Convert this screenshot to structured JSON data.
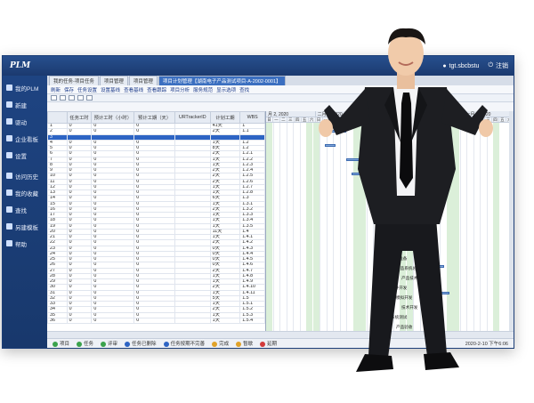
{
  "window": {
    "title": "PLM",
    "user": "tgt.sbcbstu",
    "logout": "注销"
  },
  "sidebar": {
    "items": [
      {
        "label": "我的PLM"
      },
      {
        "label": "新建"
      },
      {
        "label": "驱动"
      },
      {
        "label": "企业看板"
      },
      {
        "label": "设置"
      },
      {
        "label": "访问历史"
      },
      {
        "label": "我的收藏"
      },
      {
        "label": "查找"
      },
      {
        "label": "另建模板"
      },
      {
        "label": "帮助"
      }
    ]
  },
  "tabs": [
    {
      "label": "我的任务-项目任务",
      "active": false
    },
    {
      "label": "项目管理",
      "active": false
    },
    {
      "label": "项目管理",
      "active": false
    },
    {
      "label": "项目计划管理【湖南电子产品测试项目-A-2002-0001】",
      "active": true
    }
  ],
  "toolbar": {
    "links": [
      "刷新",
      "保存",
      "任务设置",
      "设置基线",
      "查看基线",
      "查看跟踪",
      "项目分析",
      "服务规范",
      "显示选项",
      "查找"
    ]
  },
  "grid": {
    "headers": [
      "",
      "任务工时",
      "预计工时（小时）",
      "预计工期（天）",
      "URTrackerID",
      "计划工期",
      "WBS"
    ],
    "rows": [
      [
        "1",
        "0",
        "0",
        "0",
        "",
        "41天",
        "1"
      ],
      [
        "2",
        "0",
        "0",
        "0",
        "",
        "2天",
        "1.1"
      ],
      [
        "3",
        "",
        "",
        "",
        "",
        "",
        ""
      ],
      [
        "4",
        "0",
        "0",
        "0",
        "",
        "1天",
        "1.2"
      ],
      [
        "5",
        "0",
        "0",
        "0",
        "",
        "8天",
        "1.2"
      ],
      [
        "6",
        "0",
        "0",
        "0",
        "",
        "2天",
        "1.2.1"
      ],
      [
        "7",
        "0",
        "0",
        "0",
        "",
        "1天",
        "1.2.2"
      ],
      [
        "8",
        "0",
        "0",
        "0",
        "",
        "1天",
        "1.2.3"
      ],
      [
        "9",
        "0",
        "0",
        "0",
        "",
        "2天",
        "1.2.4"
      ],
      [
        "10",
        "0",
        "0",
        "0",
        "",
        "2天",
        "1.2.5"
      ],
      [
        "11",
        "0",
        "0",
        "0",
        "",
        "2天",
        "1.2.6"
      ],
      [
        "12",
        "0",
        "0",
        "0",
        "",
        "1天",
        "1.2.7"
      ],
      [
        "13",
        "0",
        "0",
        "0",
        "",
        "1天",
        "1.2.8"
      ],
      [
        "14",
        "0",
        "0",
        "0",
        "",
        "6天",
        "1.3"
      ],
      [
        "15",
        "0",
        "0",
        "0",
        "",
        "1天",
        "1.3.1"
      ],
      [
        "16",
        "0",
        "0",
        "0",
        "",
        "2天",
        "1.3.2"
      ],
      [
        "17",
        "0",
        "0",
        "0",
        "",
        "1天",
        "1.3.3"
      ],
      [
        "18",
        "0",
        "0",
        "0",
        "",
        "1天",
        "1.3.4"
      ],
      [
        "19",
        "0",
        "0",
        "0",
        "",
        "1天",
        "1.3.5"
      ],
      [
        "20",
        "0",
        "0",
        "0",
        "",
        "11天",
        "1.4"
      ],
      [
        "21",
        "0",
        "0",
        "0",
        "",
        "1天",
        "1.4.1"
      ],
      [
        "22",
        "0",
        "0",
        "0",
        "",
        "2天",
        "1.4.2"
      ],
      [
        "23",
        "0",
        "0",
        "0",
        "",
        "0天",
        "1.4.3"
      ],
      [
        "24",
        "0",
        "0",
        "0",
        "",
        "0天",
        "1.4.4"
      ],
      [
        "25",
        "0",
        "0",
        "0",
        "",
        "0天",
        "1.4.5"
      ],
      [
        "26",
        "0",
        "0",
        "0",
        "",
        "0天",
        "1.4.6"
      ],
      [
        "27",
        "0",
        "0",
        "0",
        "",
        "2天",
        "1.4.7"
      ],
      [
        "28",
        "0",
        "0",
        "0",
        "",
        "1天",
        "1.4.8"
      ],
      [
        "29",
        "0",
        "0",
        "0",
        "",
        "1天",
        "1.4.9"
      ],
      [
        "30",
        "0",
        "0",
        "0",
        "",
        "2天",
        "1.4.10"
      ],
      [
        "31",
        "0",
        "0",
        "0",
        "",
        "1天",
        "1.4.11"
      ],
      [
        "32",
        "0",
        "0",
        "0",
        "",
        "5天",
        "1.5"
      ],
      [
        "33",
        "0",
        "0",
        "0",
        "",
        "1天",
        "1.5.1"
      ],
      [
        "34",
        "0",
        "0",
        "0",
        "",
        "2天",
        "1.5.2"
      ],
      [
        "35",
        "0",
        "0",
        "0",
        "",
        "1天",
        "1.5.3"
      ],
      [
        "36",
        "0",
        "0",
        "0",
        "",
        "1天",
        "1.5.4"
      ]
    ]
  },
  "gantt": {
    "months": [
      "月 2, 2020",
      "二月 9, 2020",
      "二月 16, 2020",
      "二月 23, 2020",
      "一月 1, 2020"
    ],
    "days": [
      "日",
      "一",
      "二",
      "三",
      "四",
      "五",
      "六"
    ],
    "labels": [
      "前期准备",
      "产品系统总体规划",
      "产品技术需求",
      "硬件开发",
      "模拟开发",
      "技术开发",
      "系统测试",
      "产品验收"
    ]
  },
  "statusbar": {
    "items": [
      "项目",
      "任务",
      "评审",
      "任务已删除",
      "任务按期不完善",
      "完成",
      "暂歇",
      "延期"
    ],
    "date": "2020-2-10 下午6:06"
  }
}
